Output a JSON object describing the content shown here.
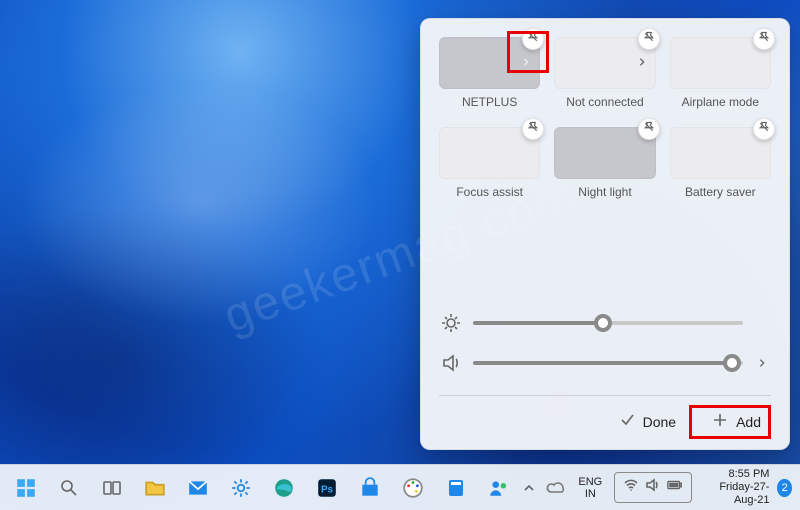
{
  "watermark": "geekermag.com",
  "quick_settings": {
    "tiles": [
      {
        "id": "wifi",
        "label": "NETPLUS",
        "active": true,
        "has_chevron": true
      },
      {
        "id": "bluetooth",
        "label": "Not connected",
        "active": false,
        "has_chevron": true
      },
      {
        "id": "airplane",
        "label": "Airplane mode",
        "active": false,
        "has_chevron": false
      },
      {
        "id": "focus",
        "label": "Focus assist",
        "active": false,
        "has_chevron": false
      },
      {
        "id": "nightlight",
        "label": "Night light",
        "active": true,
        "has_chevron": false
      },
      {
        "id": "battery",
        "label": "Battery saver",
        "active": false,
        "has_chevron": false
      }
    ],
    "brightness_pct": 48,
    "volume_pct": 96,
    "done_label": "Done",
    "add_label": "Add"
  },
  "taskbar": {
    "lang_line1": "ENG",
    "lang_line2": "IN",
    "time": "8:55 PM",
    "date": "Friday-27-Aug-21",
    "notif_count": "2"
  }
}
